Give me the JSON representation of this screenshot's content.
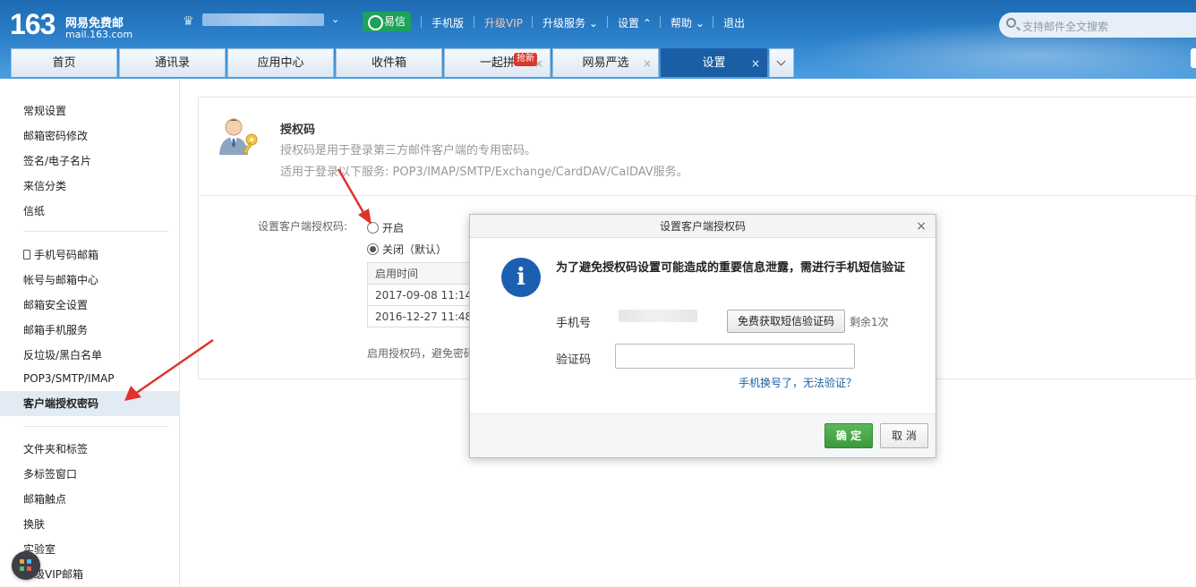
{
  "header": {
    "logo_number": "163",
    "logo_name": "网易免费邮",
    "logo_domain": "mail.163.com",
    "yixin_label": "易信",
    "nav": [
      "手机版",
      "升级VIP",
      "升级服务",
      "设置",
      "帮助",
      "退出"
    ],
    "search_placeholder": "支持邮件全文搜索"
  },
  "tabs": [
    {
      "label": "首页"
    },
    {
      "label": "通讯录"
    },
    {
      "label": "应用中心"
    },
    {
      "label": "收件箱"
    },
    {
      "label": "一起拼",
      "badge": "抢新"
    },
    {
      "label": "网易严选"
    },
    {
      "label": "设置"
    }
  ],
  "sidebar": {
    "group1": [
      "常规设置",
      "邮箱密码修改",
      "签名/电子名片",
      "来信分类",
      "信纸"
    ],
    "group2": [
      "手机号码邮箱",
      "帐号与邮箱中心",
      "邮箱安全设置",
      "邮箱手机服务",
      "反垃圾/黑白名单",
      "POP3/SMTP/IMAP",
      "客户端授权密码"
    ],
    "group3": [
      "文件夹和标签",
      "多标签窗口",
      "邮箱触点",
      "换肤",
      "实验室",
      "升级VIP邮箱"
    ]
  },
  "auth": {
    "title": "授权码",
    "desc1": "授权码是用于登录第三方邮件客户端的专用密码。",
    "desc2": "适用于登录以下服务: POP3/IMAP/SMTP/Exchange/CardDAV/CalDAV服务。",
    "setting_label": "设置客户端授权码:",
    "option_on": "开启",
    "option_off": "关闭（默认）",
    "table_header": "启用时间",
    "rows": [
      "2017-09-08 11:14:",
      "2016-12-27 11:48:"
    ],
    "hint": "启用授权码，避免密码"
  },
  "modal": {
    "title": "设置客户端授权码",
    "message": "为了避免授权码设置可能造成的重要信息泄露，需进行手机短信验证",
    "phone_label": "手机号",
    "sms_button": "免费获取短信验证码",
    "remaining": "剩余1次",
    "code_label": "验证码",
    "code_value": "",
    "forgot_link": "手机换号了，无法验证？",
    "ok": "确 定",
    "cancel": "取 消"
  },
  "colors": {
    "brand": "#1a5fa5",
    "confirm": "#3b9a3b",
    "badge": "#d9372b",
    "arrow": "#e0322c"
  }
}
